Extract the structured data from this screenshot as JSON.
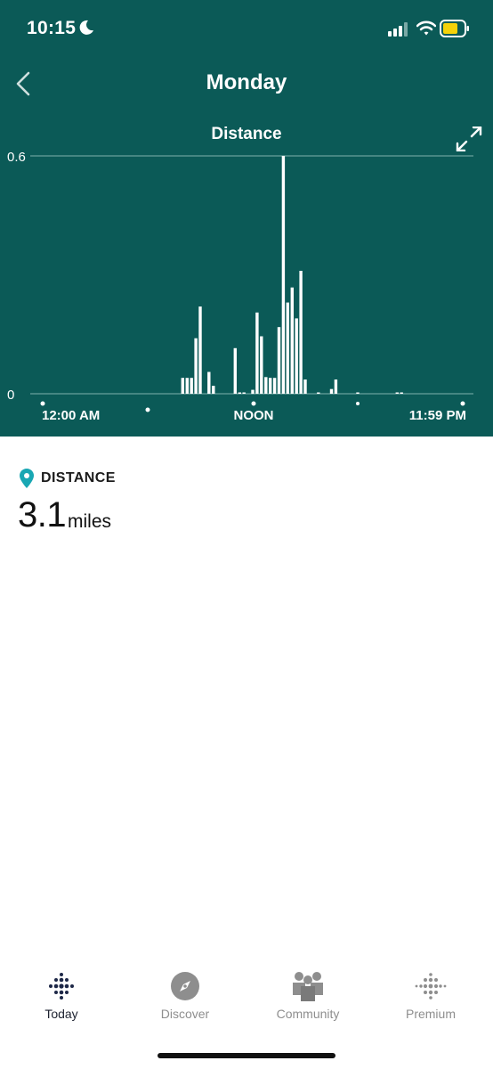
{
  "status_bar": {
    "time": "10:15"
  },
  "header": {
    "title": "Monday"
  },
  "chart_data": {
    "type": "bar",
    "title": "Distance",
    "ylim": [
      0,
      0.6
    ],
    "y_ticks": [
      "0.6",
      "0"
    ],
    "x_ticks": [
      "12:00 AM",
      "NOON",
      "11:59 PM"
    ],
    "color": "#ffffff",
    "background": "#0b5a57",
    "x_unit": "hour",
    "bars": [
      {
        "x": 8.0,
        "y": 0.04
      },
      {
        "x": 8.25,
        "y": 0.04
      },
      {
        "x": 8.5,
        "y": 0.04
      },
      {
        "x": 8.75,
        "y": 0.14
      },
      {
        "x": 9.0,
        "y": 0.22
      },
      {
        "x": 9.5,
        "y": 0.055
      },
      {
        "x": 9.75,
        "y": 0.02
      },
      {
        "x": 11.0,
        "y": 0.115
      },
      {
        "x": 11.25,
        "y": 0.003
      },
      {
        "x": 11.5,
        "y": 0.002
      },
      {
        "x": 12.0,
        "y": 0.01
      },
      {
        "x": 12.25,
        "y": 0.205
      },
      {
        "x": 12.5,
        "y": 0.145
      },
      {
        "x": 12.75,
        "y": 0.042
      },
      {
        "x": 13.0,
        "y": 0.04
      },
      {
        "x": 13.25,
        "y": 0.04
      },
      {
        "x": 13.5,
        "y": 0.168
      },
      {
        "x": 13.75,
        "y": 0.6
      },
      {
        "x": 14.0,
        "y": 0.23
      },
      {
        "x": 14.25,
        "y": 0.268
      },
      {
        "x": 14.5,
        "y": 0.19
      },
      {
        "x": 14.75,
        "y": 0.31
      },
      {
        "x": 15.0,
        "y": 0.036
      },
      {
        "x": 15.75,
        "y": 0.002
      },
      {
        "x": 16.5,
        "y": 0.012
      },
      {
        "x": 16.75,
        "y": 0.036
      },
      {
        "x": 18.0,
        "y": 0.002
      },
      {
        "x": 20.25,
        "y": 0.002
      },
      {
        "x": 20.5,
        "y": 0.002
      }
    ],
    "grid": true
  },
  "metric": {
    "label": "DISTANCE",
    "value": "3.1",
    "unit": "miles",
    "icon": "location-pin-icon",
    "icon_color": "#19a7b3"
  },
  "tabbar": {
    "items": [
      {
        "label": "Today",
        "icon": "fitbit-dots-icon",
        "active": true
      },
      {
        "label": "Discover",
        "icon": "compass-icon",
        "active": false
      },
      {
        "label": "Community",
        "icon": "community-icon",
        "active": false
      },
      {
        "label": "Premium",
        "icon": "premium-dots-icon",
        "active": false
      }
    ]
  }
}
